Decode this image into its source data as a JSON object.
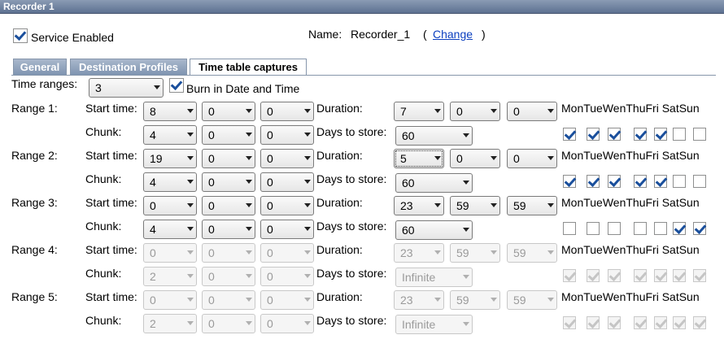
{
  "window": {
    "title": "Recorder 1"
  },
  "service": {
    "label": "Service Enabled",
    "enabled": true
  },
  "name": {
    "label": "Name:",
    "value": "Recorder_1",
    "open_paren": "(",
    "change_link": "Change",
    "close_paren": ")"
  },
  "tabs": [
    {
      "label": "General",
      "active": false
    },
    {
      "label": "Destination Profiles",
      "active": false
    },
    {
      "label": "Time table captures",
      "active": true
    }
  ],
  "time_ranges": {
    "label": "Time ranges:",
    "value": "3"
  },
  "burn_in": {
    "label": "Burn in Date and Time",
    "checked": true
  },
  "labels": {
    "start_time": "Start time:",
    "duration": "Duration:",
    "chunk": "Chunk:",
    "days_to_store": "Days to store:",
    "days_header": "MonTueWenThuFri SatSun"
  },
  "days": [
    "Mon",
    "Tue",
    "Wen",
    "Thu",
    "Fri",
    "Sat",
    "Sun"
  ],
  "ranges": [
    {
      "label": "Range 1:",
      "start": [
        "8",
        "0",
        "0"
      ],
      "duration": [
        "7",
        "0",
        "0"
      ],
      "chunk": [
        "4",
        "0",
        "0"
      ],
      "days_to_store": "60",
      "days": [
        true,
        true,
        true,
        true,
        true,
        false,
        false
      ],
      "enabled": true
    },
    {
      "label": "Range 2:",
      "start": [
        "19",
        "0",
        "0"
      ],
      "duration": [
        "5",
        "0",
        "0"
      ],
      "chunk": [
        "4",
        "0",
        "0"
      ],
      "days_to_store": "60",
      "days": [
        true,
        true,
        true,
        true,
        true,
        false,
        false
      ],
      "enabled": true
    },
    {
      "label": "Range 3:",
      "start": [
        "0",
        "0",
        "0"
      ],
      "duration": [
        "23",
        "59",
        "59"
      ],
      "chunk": [
        "4",
        "0",
        "0"
      ],
      "days_to_store": "60",
      "days": [
        false,
        false,
        false,
        false,
        false,
        true,
        true
      ],
      "enabled": true
    },
    {
      "label": "Range 4:",
      "start": [
        "0",
        "0",
        "0"
      ],
      "duration": [
        "23",
        "59",
        "59"
      ],
      "chunk": [
        "2",
        "0",
        "0"
      ],
      "days_to_store": "Infinite",
      "days": [
        true,
        true,
        true,
        true,
        true,
        true,
        true
      ],
      "enabled": false
    },
    {
      "label": "Range 5:",
      "start": [
        "0",
        "0",
        "0"
      ],
      "duration": [
        "23",
        "59",
        "59"
      ],
      "chunk": [
        "2",
        "0",
        "0"
      ],
      "days_to_store": "Infinite",
      "days": [
        true,
        true,
        true,
        true,
        true,
        true,
        true
      ],
      "enabled": false
    }
  ]
}
